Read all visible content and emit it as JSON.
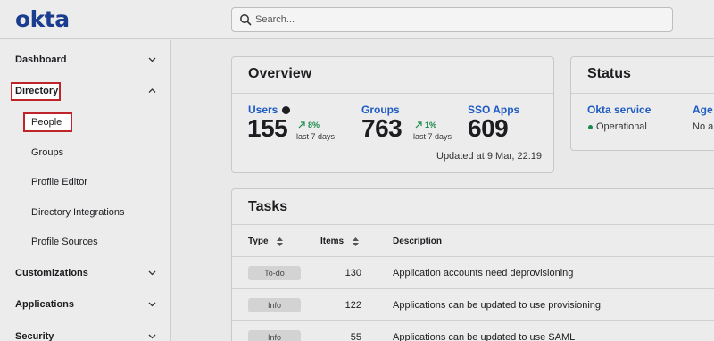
{
  "header": {
    "logo": "okta",
    "search_placeholder": "Search..."
  },
  "sidebar": {
    "items": [
      {
        "label": "Dashboard"
      },
      {
        "label": "Directory"
      },
      {
        "label": "Customizations"
      },
      {
        "label": "Applications"
      },
      {
        "label": "Security"
      }
    ],
    "directory_children": [
      {
        "label": "People"
      },
      {
        "label": "Groups"
      },
      {
        "label": "Profile Editor"
      },
      {
        "label": "Directory Integrations"
      },
      {
        "label": "Profile Sources"
      }
    ]
  },
  "overview": {
    "title": "Overview",
    "metrics": [
      {
        "label": "Users",
        "value": "155",
        "trend": "8%",
        "trend_sub": "last 7 days"
      },
      {
        "label": "Groups",
        "value": "763",
        "trend": "1%",
        "trend_sub": "last 7 days"
      },
      {
        "label": "SSO Apps",
        "value": "609"
      }
    ],
    "updated": "Updated at 9 Mar, 22:19"
  },
  "status": {
    "title": "Status",
    "service_label": "Okta service",
    "service_state": "Operational",
    "agents_label": "Age",
    "agents_state": "No a"
  },
  "tasks": {
    "title": "Tasks",
    "columns": {
      "type": "Type",
      "items": "Items",
      "description": "Description"
    },
    "rows": [
      {
        "type": "To-do",
        "items": "130",
        "description": "Application accounts need deprovisioning"
      },
      {
        "type": "Info",
        "items": "122",
        "description": "Applications can be updated to use provisioning"
      },
      {
        "type": "Info",
        "items": "55",
        "description": "Applications can be updated to use SAML"
      }
    ]
  },
  "colors": {
    "accent_blue": "#1f5bc4",
    "logo_blue": "#1b3d8f",
    "highlight_red": "#c0242b",
    "trend_green": "#1a8a4a"
  }
}
